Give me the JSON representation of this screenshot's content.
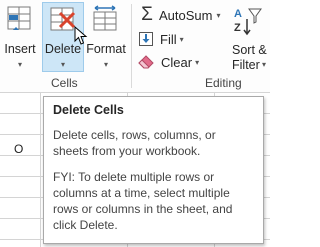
{
  "ribbon": {
    "insert_label": "Insert",
    "delete_label": "Delete",
    "format_label": "Format",
    "cells_group_label": "Cells",
    "autosum_label": "AutoSum",
    "fill_label": "Fill",
    "clear_label": "Clear",
    "sort_label_line1": "Sort &",
    "sort_label_line2": "Filter",
    "editing_group_label": "Editing",
    "dropdown_glyph": "▾"
  },
  "grid": {
    "cell_text": "O"
  },
  "tooltip": {
    "title": "Delete Cells",
    "body": "Delete cells, rows, columns, or sheets from your workbook.",
    "fyi": "FYI: To delete multiple rows or columns at a time, select multiple rows or columns in the sheet, and click Delete."
  },
  "colors": {
    "accent_red": "#d9442d",
    "accent_blue": "#2e75b6",
    "hover_highlight": "#cde6f7"
  }
}
